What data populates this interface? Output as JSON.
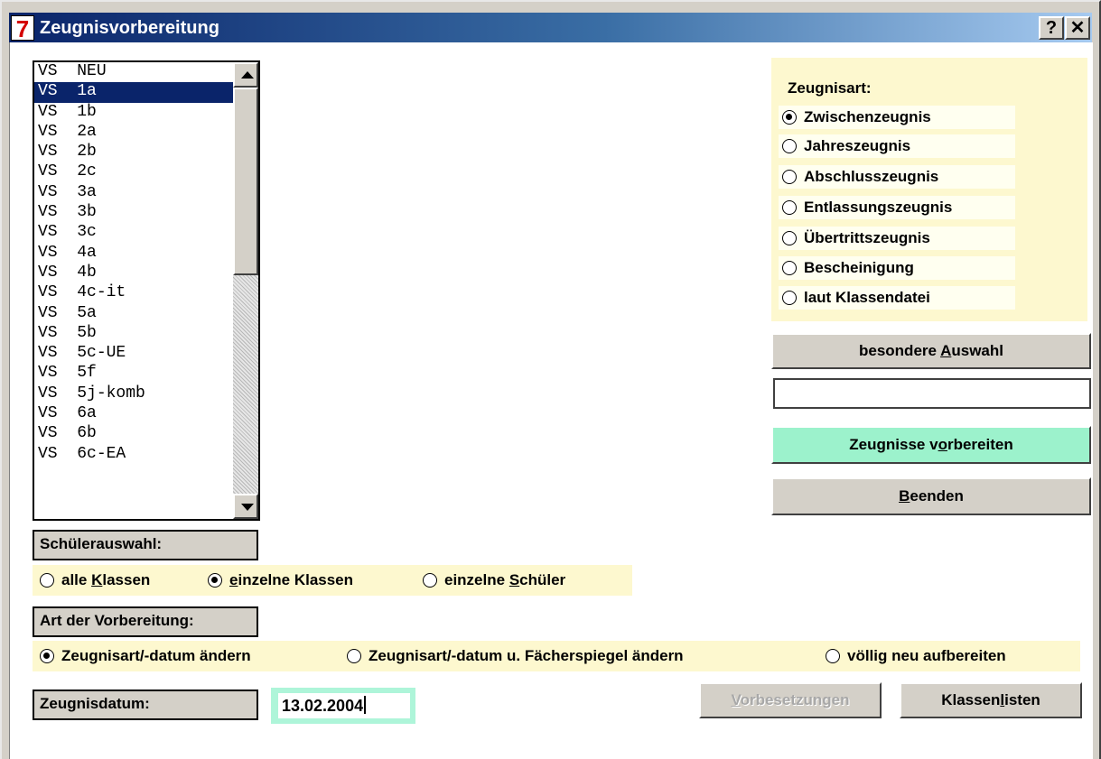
{
  "window": {
    "icon_glyph": "7",
    "title": "Zeugnisvorbereitung",
    "help_glyph": "?",
    "close_glyph": "✕"
  },
  "class_list": {
    "rows": [
      {
        "prefix": "VS",
        "name": "NEU",
        "selected": false
      },
      {
        "prefix": "VS",
        "name": "1a",
        "selected": true
      },
      {
        "prefix": "VS",
        "name": "1b",
        "selected": false
      },
      {
        "prefix": "VS",
        "name": "2a",
        "selected": false
      },
      {
        "prefix": "VS",
        "name": "2b",
        "selected": false
      },
      {
        "prefix": "VS",
        "name": "2c",
        "selected": false
      },
      {
        "prefix": "VS",
        "name": "3a",
        "selected": false
      },
      {
        "prefix": "VS",
        "name": "3b",
        "selected": false
      },
      {
        "prefix": "VS",
        "name": "3c",
        "selected": false
      },
      {
        "prefix": "VS",
        "name": "4a",
        "selected": false
      },
      {
        "prefix": "VS",
        "name": "4b",
        "selected": false
      },
      {
        "prefix": "VS",
        "name": "4c-it",
        "selected": false
      },
      {
        "prefix": "VS",
        "name": "5a",
        "selected": false
      },
      {
        "prefix": "VS",
        "name": "5b",
        "selected": false
      },
      {
        "prefix": "VS",
        "name": "5c-UE",
        "selected": false
      },
      {
        "prefix": "VS",
        "name": "5f",
        "selected": false
      },
      {
        "prefix": "VS",
        "name": "5j-komb",
        "selected": false
      },
      {
        "prefix": "VS",
        "name": "6a",
        "selected": false
      },
      {
        "prefix": "VS",
        "name": "6b",
        "selected": false
      },
      {
        "prefix": "VS",
        "name": "6c-EA",
        "selected": false
      }
    ]
  },
  "zeugnisart": {
    "label": "Zeugnisart:",
    "options": [
      {
        "label": "Zwischenzeugnis",
        "selected": true
      },
      {
        "label": "Jahreszeugnis",
        "selected": false
      },
      {
        "label": "Abschlusszeugnis",
        "selected": false
      },
      {
        "label": "Entlassungszeugnis",
        "selected": false
      },
      {
        "label": "Übertrittszeugnis",
        "selected": false
      },
      {
        "label": "Bescheinigung",
        "selected": false
      },
      {
        "label": "laut Klassendatei",
        "selected": false
      }
    ]
  },
  "buttons": {
    "auswahl_pre": "besondere ",
    "auswahl_key": "A",
    "auswahl_post": "uswahl",
    "vorbereiten_pre": "Zeugnisse v",
    "vorbereiten_key": "o",
    "vorbereiten_post": "rbereiten",
    "beenden_key": "B",
    "beenden_post": "eenden",
    "vorbesetzungen_key": "V",
    "vorbesetzungen_post": "orbesetzungen",
    "klassenlisten_pre": "Klassen",
    "klassenlisten_key": "l",
    "klassenlisten_post": "isten"
  },
  "auswahl_field": {
    "value": ""
  },
  "schuelerauswahl": {
    "label": "Schülerauswahl:",
    "options": [
      {
        "pre": "alle ",
        "key": "K",
        "post": "lassen",
        "selected": false
      },
      {
        "pre": "",
        "key": "e",
        "post": "inzelne Klassen",
        "selected": true
      },
      {
        "pre": "einzelne ",
        "key": "S",
        "post": "chüler",
        "selected": false
      }
    ]
  },
  "vorbereitung": {
    "label": "Art der Vorbereitung:",
    "options": [
      {
        "label": "Zeugnisart/-datum ändern",
        "selected": true
      },
      {
        "label": "Zeugnisart/-datum u. Fächerspiegel ändern",
        "selected": false
      },
      {
        "label": "völlig neu aufbereiten",
        "selected": false
      }
    ]
  },
  "zeugnisdatum": {
    "label": "Zeugnisdatum:",
    "value": "13.02.2004"
  }
}
